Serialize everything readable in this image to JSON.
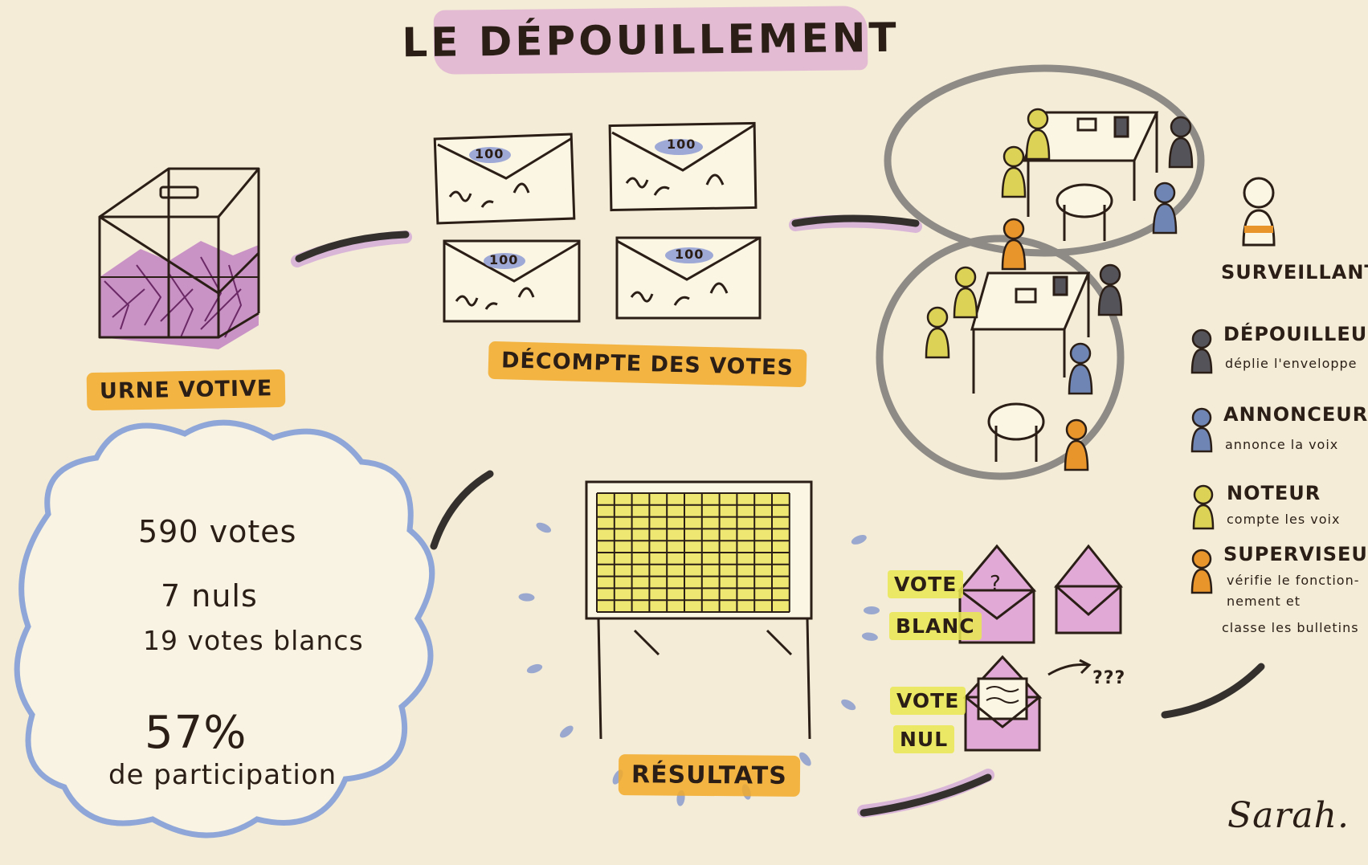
{
  "title": "LE DÉPOUILLEMENT",
  "ballot_box": {
    "label": "URNE VOTIVE"
  },
  "count": {
    "label": "DÉCOMPTE DES VOTES",
    "envelope_value": "100"
  },
  "stats": {
    "votes": "590 votes",
    "nuls": "7 nuls",
    "blancs": "19 votes blancs",
    "participation_pct": "57%",
    "participation_label": "de participation"
  },
  "results": {
    "label": "RÉSULTATS"
  },
  "legend": {
    "surveillant": "SURVEILLANT",
    "roles": [
      {
        "title": "DÉPOUILLEUR",
        "desc": "déplie l'enveloppe",
        "color": "#55535a"
      },
      {
        "title": "ANNONCEUR",
        "desc": "annonce la voix",
        "color": "#6f86b5"
      },
      {
        "title": "NOTEUR",
        "desc": "compte les voix",
        "color": "#dcd356"
      },
      {
        "title": "SUPERVISEUR",
        "desc_lines": [
          "vérifie le fonction-",
          "nement et",
          "classe les bulletins"
        ],
        "color": "#e8952c"
      }
    ]
  },
  "vote_blanc": {
    "line1": "VOTE",
    "line2": "BLANC",
    "envelope_mark": "?"
  },
  "vote_nul": {
    "line1": "VOTE",
    "line2": "NUL",
    "mark": "???"
  },
  "signature": "Sarah.",
  "colors": {
    "paper": "#f4ecd6",
    "ink": "#2a1e16",
    "pink": "#d69ad4",
    "orange": "#f2aa28",
    "yellow": "#e8e850",
    "blue": "#8ea6d8"
  }
}
